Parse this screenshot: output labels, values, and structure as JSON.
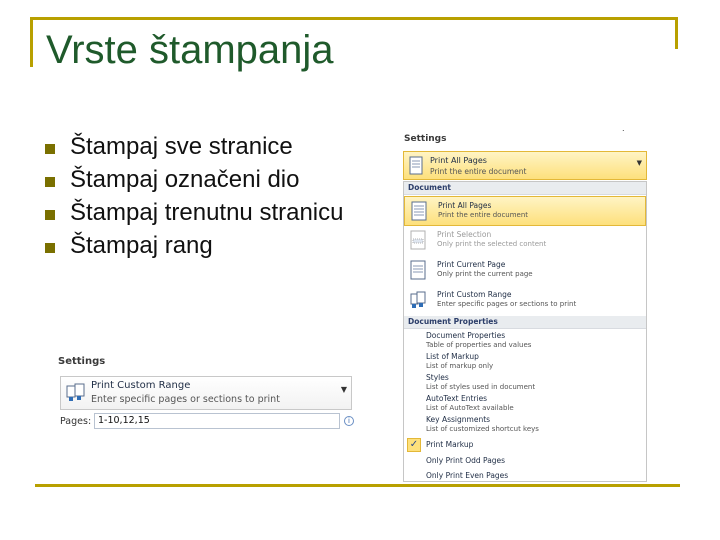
{
  "slide": {
    "title": "Vrste štampanja",
    "accent": "#b8a000",
    "title_color": "#1f5a2b",
    "bullets": [
      "Štampaj sve stranice",
      "Štampaj označeni dio",
      "Štampaj trenutnu stranicu",
      "Štampaj rang"
    ]
  },
  "small_panel": {
    "title": "Settings",
    "selected_main": "Print Custom Range",
    "selected_sub": "Enter specific pages or sections to print",
    "dropdown_icon": "chevron-down-icon",
    "pages_label": "Pages:",
    "pages_value": "1-10,12,15",
    "info_icon": "info-icon"
  },
  "big_panel": {
    "title": "Settings",
    "selected_main": "Print All Pages",
    "selected_sub": "Print the entire document",
    "document_section": "Document",
    "items": [
      {
        "main": "Print All Pages",
        "sub": "Print the entire document"
      },
      {
        "main": "Print Selection",
        "sub": "Only print the selected content"
      },
      {
        "main": "Print Current Page",
        "sub": "Only print the current page"
      },
      {
        "main": "Print Custom Range",
        "sub": "Enter specific pages or sections to print"
      }
    ],
    "properties_section": "Document Properties",
    "properties": [
      {
        "main": "Document Properties",
        "sub": "Table of properties and values"
      },
      {
        "main": "List of Markup",
        "sub": "List of markup only"
      },
      {
        "main": "Styles",
        "sub": "List of styles used in document"
      },
      {
        "main": "AutoText Entries",
        "sub": "List of AutoText available"
      },
      {
        "main": "Key Assignments",
        "sub": "List of customized shortcut keys"
      }
    ],
    "options": [
      {
        "label": "Print Markup",
        "checked": true
      },
      {
        "label": "Only Print Odd Pages"
      },
      {
        "label": "Only Print Even Pages"
      }
    ]
  }
}
